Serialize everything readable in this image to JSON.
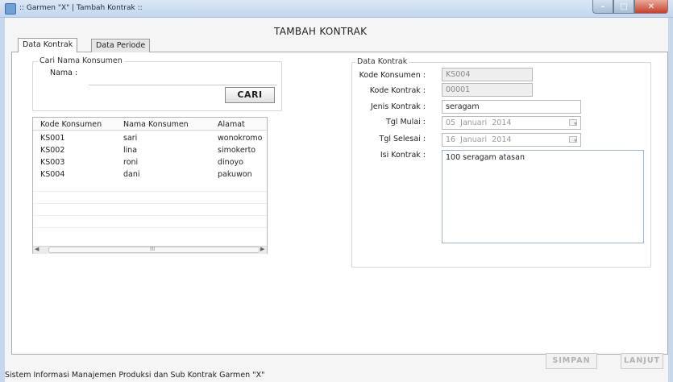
{
  "window": {
    "title": ":: Garmen \"X\" | Tambah Kontrak ::",
    "controls": [
      "minimize-icon",
      "maximize-icon",
      "close-icon"
    ]
  },
  "page": {
    "title": "TAMBAH KONTRAK"
  },
  "tabs": [
    {
      "label": "Data Kontrak",
      "active": true
    },
    {
      "label": "Data Periode",
      "active": false
    }
  ],
  "search": {
    "group_label": "Cari Nama Konsumen",
    "nama_label": "Nama :",
    "nama_value": "",
    "button_label": "CARI"
  },
  "table": {
    "columns": [
      "Kode Konsumen",
      "Nama Konsumen",
      "Alamat"
    ],
    "rows": [
      [
        "KS001",
        "sari",
        "wonokromo"
      ],
      [
        "KS002",
        "lina",
        "simokerto"
      ],
      [
        "KS003",
        "roni",
        "dinoyo"
      ],
      [
        "KS004",
        "dani",
        "pakuwon"
      ]
    ],
    "scroll_grip": "III"
  },
  "form": {
    "group_label": "Data Kontrak",
    "kode_konsumen": {
      "label": "Kode Konsumen :",
      "value": "KS004"
    },
    "kode_kontrak": {
      "label": "Kode Kontrak :",
      "value": "00001"
    },
    "jenis_kontrak": {
      "label": "Jenis Kontrak :",
      "value": "seragam"
    },
    "tgl_mulai": {
      "label": "Tgl Mulai :",
      "day": "05",
      "month": "Januari",
      "year": "2014"
    },
    "tgl_selesai": {
      "label": "Tgl Selesai :",
      "day": "16",
      "month": "Januari",
      "year": "2014"
    },
    "isi_kontrak": {
      "label": "Isi Kontrak :",
      "value": "100 seragam atasan"
    }
  },
  "buttons": {
    "simpan": "SIMPAN",
    "lanjut": "LANJUT"
  },
  "status_bar": "Sistem Informasi Manajemen Produksi dan Sub Kontrak Garmen \"X\"",
  "colors": {
    "title_bar": "#c3d6ee",
    "close_button": "#c7412a",
    "text_area_border": "#9fb3d0"
  }
}
